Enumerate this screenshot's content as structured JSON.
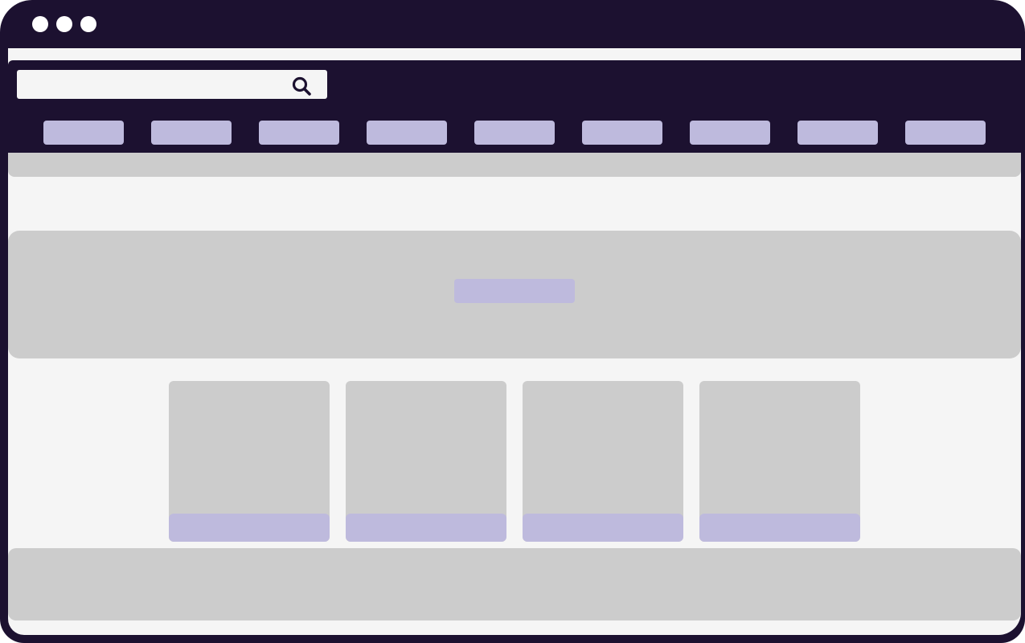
{
  "window": {
    "controls": [
      "window-dot-icon",
      "window-dot-icon",
      "window-dot-icon"
    ]
  },
  "search": {
    "icon": "search-icon",
    "placeholder": ""
  },
  "nav": {
    "items": [
      {},
      {},
      {},
      {},
      {},
      {},
      {},
      {},
      {}
    ]
  },
  "hero": {
    "button": {}
  },
  "cards": [
    {},
    {},
    {},
    {}
  ],
  "colors": {
    "frame": "#1c1130",
    "background": "#f5f5f5",
    "placeholder_block": "#cccccc",
    "accent": "#bebadd",
    "dots": "#ffffff"
  }
}
